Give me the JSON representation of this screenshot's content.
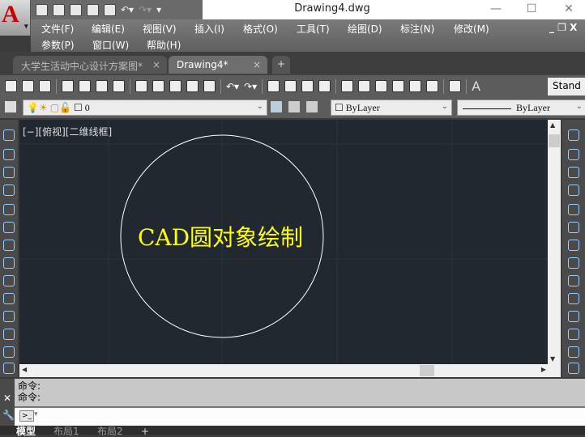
{
  "app": {
    "logo": "A",
    "title": "Drawing4.dwg"
  },
  "window_controls": {
    "minimize": "—",
    "maximize": "☐",
    "close": "✕"
  },
  "menu_row1": [
    "文件(F)",
    "编辑(E)",
    "视图(V)",
    "插入(I)",
    "格式(O)",
    "工具(T)",
    "绘图(D)",
    "标注(N)",
    "修改(M)"
  ],
  "menu_row2": [
    "参数(P)",
    "窗口(W)",
    "帮助(H)"
  ],
  "doc_controls": "_ ❐ X",
  "tabs": [
    {
      "label": "大学生活动中心设计方案图*",
      "active": false
    },
    {
      "label": "Drawing4*",
      "active": true
    }
  ],
  "tab_close": "×",
  "new_tab": "+",
  "toolbar": {
    "text_style": "Stand"
  },
  "layer": {
    "value": "0"
  },
  "color": {
    "value": "ByLayer"
  },
  "linetype": {
    "value": "ByLayer"
  },
  "viewport": {
    "label": "[−][俯视][二维线框]",
    "text": "CAD圆对象绘制"
  },
  "command": {
    "lines": [
      "命令:",
      "命令:"
    ],
    "prompt_icon": ">_"
  },
  "layout_tabs": [
    "模型",
    "布局1",
    "布局2"
  ],
  "colors": {
    "canvas": "#212830",
    "text": "#ffff00",
    "circle": "#ffffff"
  }
}
